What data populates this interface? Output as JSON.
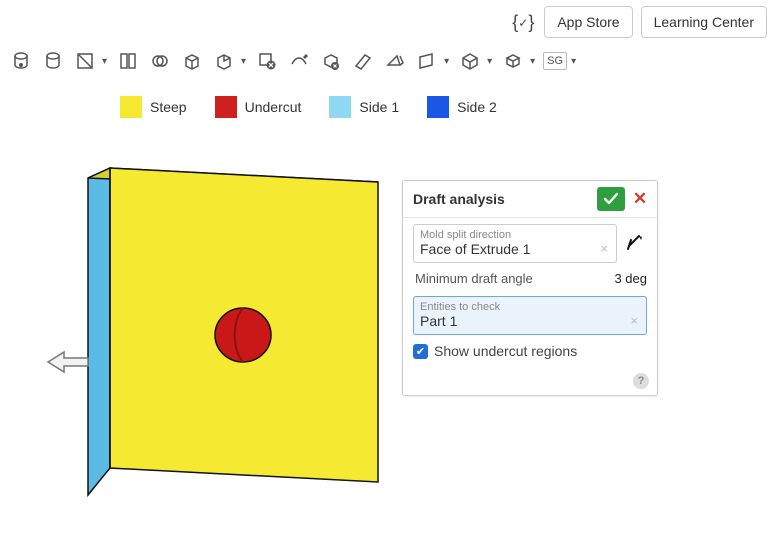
{
  "colors": {
    "steep": "#f5e931",
    "undercut": "#d01f1f",
    "side1": "#8fd7f2",
    "side2": "#1b57e6",
    "edge": "#111111"
  },
  "topbar": {
    "app_store": "App Store",
    "learning_center": "Learning Center"
  },
  "legend": {
    "steep": "Steep",
    "undercut": "Undercut",
    "side1": "Side 1",
    "side2": "Side 2"
  },
  "panel": {
    "title": "Draft analysis",
    "mold_label": "Mold split direction",
    "mold_value": "Face of Extrude 1",
    "min_angle_label": "Minimum draft angle",
    "min_angle_value": "3 deg",
    "entities_label": "Entities to check",
    "entities_value": "Part 1",
    "show_undercut": "Show undercut regions"
  }
}
